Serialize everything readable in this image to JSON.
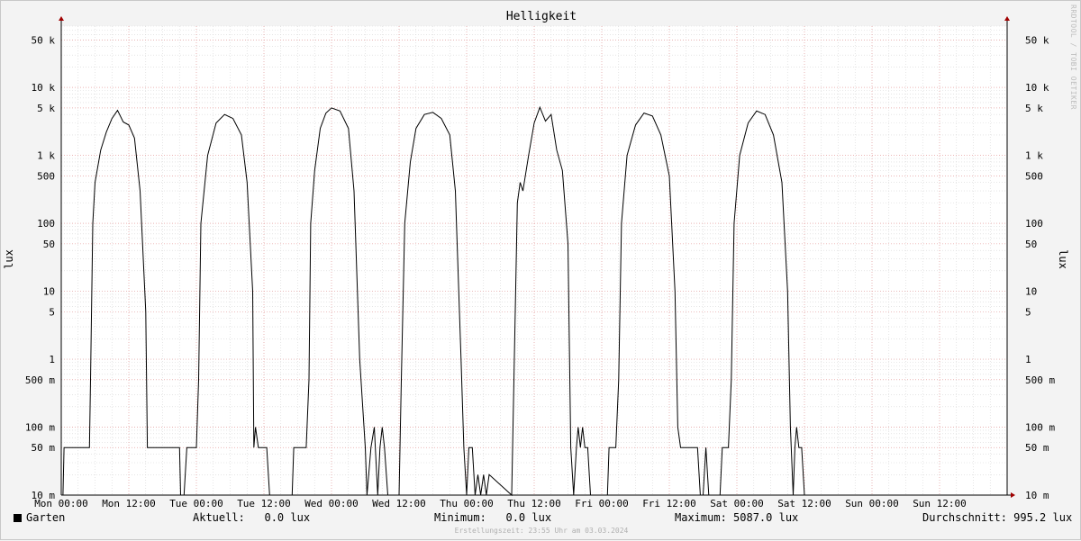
{
  "chart_data": {
    "type": "line",
    "title": "Helligkeit",
    "ylabel": "lux",
    "yscale": "log",
    "ylim": [
      0.01,
      80000
    ],
    "xlim": [
      0,
      168
    ],
    "x_tick_labels": [
      "Mon 00:00",
      "Mon 12:00",
      "Tue 00:00",
      "Tue 12:00",
      "Wed 00:00",
      "Wed 12:00",
      "Thu 00:00",
      "Thu 12:00",
      "Fri 00:00",
      "Fri 12:00",
      "Sat 00:00",
      "Sat 12:00",
      "Sun 00:00",
      "Sun 12:00"
    ],
    "y_ticks": [
      {
        "value": 0.01,
        "label": "10 m"
      },
      {
        "value": 0.05,
        "label": "50 m"
      },
      {
        "value": 0.1,
        "label": "100 m"
      },
      {
        "value": 0.5,
        "label": "500 m"
      },
      {
        "value": 1,
        "label": "1"
      },
      {
        "value": 5,
        "label": "5"
      },
      {
        "value": 10,
        "label": "10"
      },
      {
        "value": 50,
        "label": "50"
      },
      {
        "value": 100,
        "label": "100"
      },
      {
        "value": 500,
        "label": "500"
      },
      {
        "value": 1000,
        "label": "1 k"
      },
      {
        "value": 5000,
        "label": "5 k"
      },
      {
        "value": 10000,
        "label": "10 k"
      },
      {
        "value": 50000,
        "label": "50 k"
      }
    ],
    "grid": true,
    "series": [
      {
        "name": "Garten",
        "color": "#000000",
        "points": [
          [
            0,
            0.01
          ],
          [
            0.3,
            0.01
          ],
          [
            0.5,
            0.05
          ],
          [
            5,
            0.05
          ],
          [
            5.2,
            0.5
          ],
          [
            5.6,
            100
          ],
          [
            6,
            400
          ],
          [
            7,
            1200
          ],
          [
            8,
            2200
          ],
          [
            9,
            3500
          ],
          [
            10,
            4600
          ],
          [
            11,
            3100
          ],
          [
            12,
            2800
          ],
          [
            13,
            1800
          ],
          [
            14,
            300
          ],
          [
            15,
            5
          ],
          [
            15.3,
            0.05
          ],
          [
            21,
            0.05
          ],
          [
            21.2,
            0.01
          ],
          [
            21.8,
            0.01
          ],
          [
            22.3,
            0.05
          ],
          [
            24,
            0.05
          ],
          [
            24.4,
            0.5
          ],
          [
            24.8,
            100
          ],
          [
            26,
            1000
          ],
          [
            27.5,
            3000
          ],
          [
            29,
            4000
          ],
          [
            30.5,
            3500
          ],
          [
            32,
            2000
          ],
          [
            33,
            400
          ],
          [
            34,
            10
          ],
          [
            34.2,
            0.05
          ],
          [
            34.5,
            0.1
          ],
          [
            35,
            0.05
          ],
          [
            36.5,
            0.05
          ],
          [
            37,
            0.01
          ],
          [
            41,
            0.01
          ],
          [
            41.3,
            0.05
          ],
          [
            43.5,
            0.05
          ],
          [
            44,
            0.5
          ],
          [
            44.3,
            100
          ],
          [
            45,
            600
          ],
          [
            46,
            2500
          ],
          [
            47,
            4200
          ],
          [
            48,
            5000
          ],
          [
            49.5,
            4500
          ],
          [
            51,
            2500
          ],
          [
            52,
            300
          ],
          [
            53,
            1
          ],
          [
            54,
            0.05
          ],
          [
            54.3,
            0.01
          ],
          [
            55,
            0.05
          ],
          [
            55.6,
            0.1
          ],
          [
            56.2,
            0.01
          ],
          [
            56.6,
            0.05
          ],
          [
            57,
            0.1
          ],
          [
            57.4,
            0.05
          ],
          [
            58,
            0.01
          ],
          [
            60,
            0.01
          ],
          [
            60.4,
            0.5
          ],
          [
            61,
            100
          ],
          [
            62,
            800
          ],
          [
            63,
            2500
          ],
          [
            64.5,
            4000
          ],
          [
            66,
            4300
          ],
          [
            67.5,
            3500
          ],
          [
            69,
            2000
          ],
          [
            70,
            300
          ],
          [
            71,
            1
          ],
          [
            71.5,
            0.05
          ],
          [
            72,
            0.01
          ],
          [
            72.4,
            0.05
          ],
          [
            73,
            0.05
          ],
          [
            73.5,
            0.01
          ],
          [
            74,
            0.02
          ],
          [
            74.5,
            0.01
          ],
          [
            75,
            0.02
          ],
          [
            75.5,
            0.01
          ],
          [
            76,
            0.02
          ],
          [
            80,
            0.01
          ],
          [
            80.4,
            0.5
          ],
          [
            81,
            200
          ],
          [
            81.5,
            400
          ],
          [
            82,
            300
          ],
          [
            83,
            1000
          ],
          [
            84,
            3000
          ],
          [
            85,
            5100
          ],
          [
            86,
            3200
          ],
          [
            87,
            4000
          ],
          [
            88,
            1200
          ],
          [
            89,
            600
          ],
          [
            90,
            50
          ],
          [
            90.5,
            0.05
          ],
          [
            91,
            0.01
          ],
          [
            91.5,
            0.05
          ],
          [
            91.8,
            0.1
          ],
          [
            92.2,
            0.05
          ],
          [
            92.6,
            0.1
          ],
          [
            93,
            0.05
          ],
          [
            93.5,
            0.05
          ],
          [
            94,
            0.01
          ],
          [
            97,
            0.01
          ],
          [
            97.3,
            0.05
          ],
          [
            98.5,
            0.05
          ],
          [
            99,
            0.5
          ],
          [
            99.5,
            100
          ],
          [
            100.5,
            1000
          ],
          [
            102,
            2800
          ],
          [
            103.5,
            4200
          ],
          [
            105,
            3800
          ],
          [
            106.5,
            2000
          ],
          [
            108,
            500
          ],
          [
            109,
            10
          ],
          [
            109.5,
            0.1
          ],
          [
            110,
            0.05
          ],
          [
            113,
            0.05
          ],
          [
            113.5,
            0.01
          ],
          [
            114,
            0.01
          ],
          [
            114.5,
            0.05
          ],
          [
            115,
            0.01
          ],
          [
            117,
            0.01
          ],
          [
            117.4,
            0.05
          ],
          [
            118.5,
            0.05
          ],
          [
            119,
            0.5
          ],
          [
            119.5,
            100
          ],
          [
            120.5,
            1000
          ],
          [
            122,
            3000
          ],
          [
            123.5,
            4500
          ],
          [
            125,
            4000
          ],
          [
            126.5,
            2000
          ],
          [
            128,
            400
          ],
          [
            129,
            10
          ],
          [
            129.5,
            0.1
          ],
          [
            130,
            0.01
          ],
          [
            130.3,
            0.05
          ],
          [
            130.6,
            0.1
          ],
          [
            131,
            0.05
          ],
          [
            131.5,
            0.05
          ],
          [
            132,
            0.01
          ],
          [
            132.5,
            0.01
          ]
        ]
      }
    ]
  },
  "watermark": "RRDTOOL / TOBI OETIKER",
  "legend": {
    "series_name": "Garten",
    "current_label": "Aktuell:",
    "current_value": "0.0 lux",
    "min_label": "Minimum:",
    "min_value": "0.0 lux",
    "max_label": "Maximum:",
    "max_value": "5087.0 lux",
    "avg_label": "Durchschnitt:",
    "avg_value": "995.2 lux"
  },
  "footer": "Erstellungszeit: 23:55 Uhr am 03.03.2024"
}
